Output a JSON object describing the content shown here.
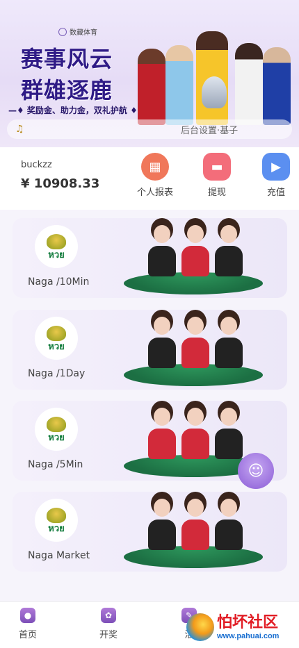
{
  "banner": {
    "brand": "数藏体育",
    "headline_line1": "赛事风云",
    "headline_line2": "群雄逐鹿",
    "tagline": "—♦ 奖励金、助力金，双礼护航 ♦—",
    "notice_text": "后台设置·基子",
    "speaker_icon": "speaker-icon"
  },
  "account": {
    "username": "buckzz",
    "balance": "¥ 10908.33",
    "actions": [
      {
        "label": "个人报表",
        "icon": "calendar-icon",
        "color": "#f0775a"
      },
      {
        "label": "提现",
        "icon": "card-icon",
        "color": "#f36d7a"
      },
      {
        "label": "充值",
        "icon": "wallet-icon",
        "color": "#5b8ff0"
      }
    ]
  },
  "games": [
    {
      "name": "Naga /10Min",
      "logo_text": "หวย"
    },
    {
      "name": "Naga /1Day",
      "logo_text": "หวย"
    },
    {
      "name": "Naga /5Min",
      "logo_text": "หวย"
    },
    {
      "name": "Naga Market",
      "logo_text": "หวย"
    }
  ],
  "nav": {
    "home": "首页",
    "draw": "开奖",
    "third": "活"
  },
  "watermark": {
    "title": "怕坏社区",
    "url": "www.pahuai.com"
  },
  "colors": {
    "accent": "#7d4fb8",
    "headline": "#2f1b86"
  }
}
